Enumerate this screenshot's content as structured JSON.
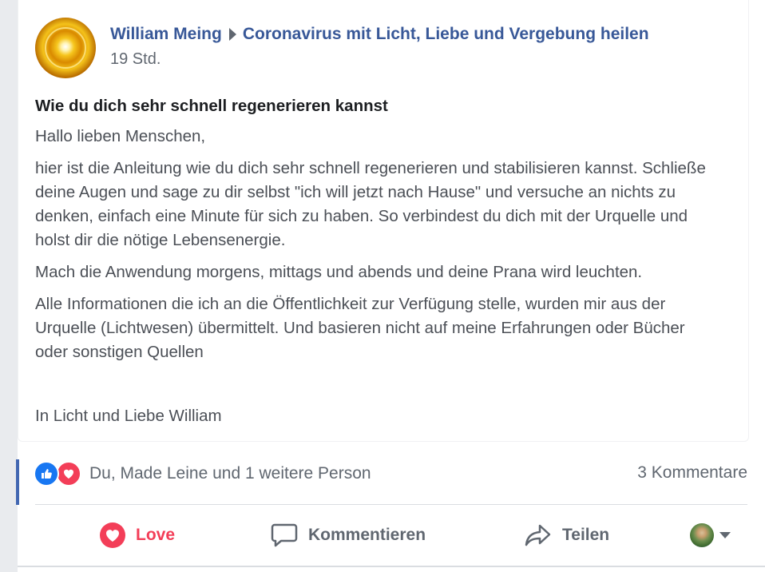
{
  "post": {
    "author": "William Meing",
    "group": "Coronavirus mit Licht, Liebe und Vergebung heilen",
    "time": "19 Std.",
    "title": "Wie du dich sehr schnell regenerieren kannst",
    "greeting": "Hallo lieben Menschen,",
    "para1": "hier ist die Anleitung wie du dich sehr schnell regenerieren und stabilisieren kannst. Schließe deine Augen und sage zu dir selbst \"ich will jetzt nach Hause\" und versuche an nichts zu denken, einfach eine Minute für sich zu haben. So verbindest du dich mit der Urquelle und holst dir die nötige Lebensenergie.",
    "para2": "Mach die Anwendung morgens, mittags und abends und deine Prana wird leuchten.",
    "para3": "Alle Informationen die ich an die Öffentlichkeit zur Verfügung stelle, wurden mir aus der Urquelle (Lichtwesen) übermittelt. Und basieren nicht auf meine Erfahrungen oder Bücher oder sonstigen Quellen",
    "signoff": "In Licht und Liebe William"
  },
  "reactions": {
    "icons": [
      "like-icon",
      "love-icon"
    ],
    "summary": "Du, Made Leine und 1 weitere Person",
    "comments": "3 Kommentare"
  },
  "actions": {
    "love": "Love",
    "comment": "Kommentieren",
    "share": "Teilen"
  },
  "colors": {
    "link": "#385898",
    "love": "#f33e58",
    "like": "#1877f2",
    "text": "#4b4f56",
    "muted": "#606770"
  }
}
